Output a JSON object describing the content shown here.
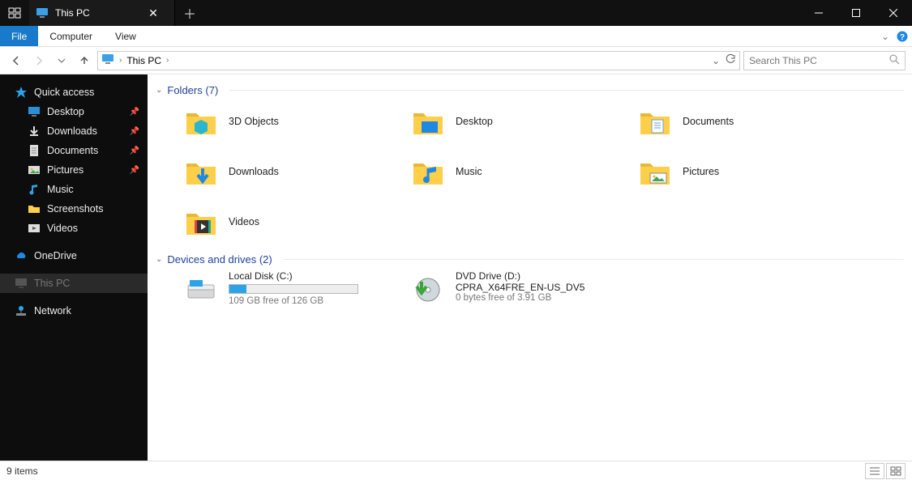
{
  "window": {
    "title": "This PC",
    "tabs": [
      {
        "label": "This PC"
      }
    ]
  },
  "ribbon": {
    "file": "File",
    "tabs": [
      "Computer",
      "View"
    ]
  },
  "address": {
    "crumbs": [
      "This PC"
    ]
  },
  "search": {
    "placeholder": "Search This PC"
  },
  "sidebar": {
    "quick_access": "Quick access",
    "pinned": [
      {
        "label": "Desktop",
        "icon": "desktop"
      },
      {
        "label": "Downloads",
        "icon": "download"
      },
      {
        "label": "Documents",
        "icon": "document"
      },
      {
        "label": "Pictures",
        "icon": "pictures"
      }
    ],
    "items": [
      {
        "label": "Music",
        "icon": "music"
      },
      {
        "label": "Screenshots",
        "icon": "folder"
      },
      {
        "label": "Videos",
        "icon": "videos"
      }
    ],
    "onedrive": "OneDrive",
    "this_pc": "This PC",
    "network": "Network"
  },
  "groups": {
    "folders": {
      "title": "Folders",
      "count": 7
    },
    "drives": {
      "title": "Devices and drives",
      "count": 2
    }
  },
  "folders": [
    {
      "label": "3D Objects",
      "icon": "3d"
    },
    {
      "label": "Desktop",
      "icon": "desktop"
    },
    {
      "label": "Documents",
      "icon": "document"
    },
    {
      "label": "Downloads",
      "icon": "download"
    },
    {
      "label": "Music",
      "icon": "music"
    },
    {
      "label": "Pictures",
      "icon": "pictures"
    },
    {
      "label": "Videos",
      "icon": "videos"
    }
  ],
  "drives": [
    {
      "label": "Local Disk (C:)",
      "sub": "109 GB free of 126 GB",
      "fill_pct": 13,
      "icon": "hdd"
    },
    {
      "label": "DVD Drive (D:)",
      "label2": "CPRA_X64FRE_EN-US_DV5",
      "sub": "0 bytes free of 3.91 GB",
      "icon": "dvd"
    }
  ],
  "status": {
    "text": "9 items"
  }
}
